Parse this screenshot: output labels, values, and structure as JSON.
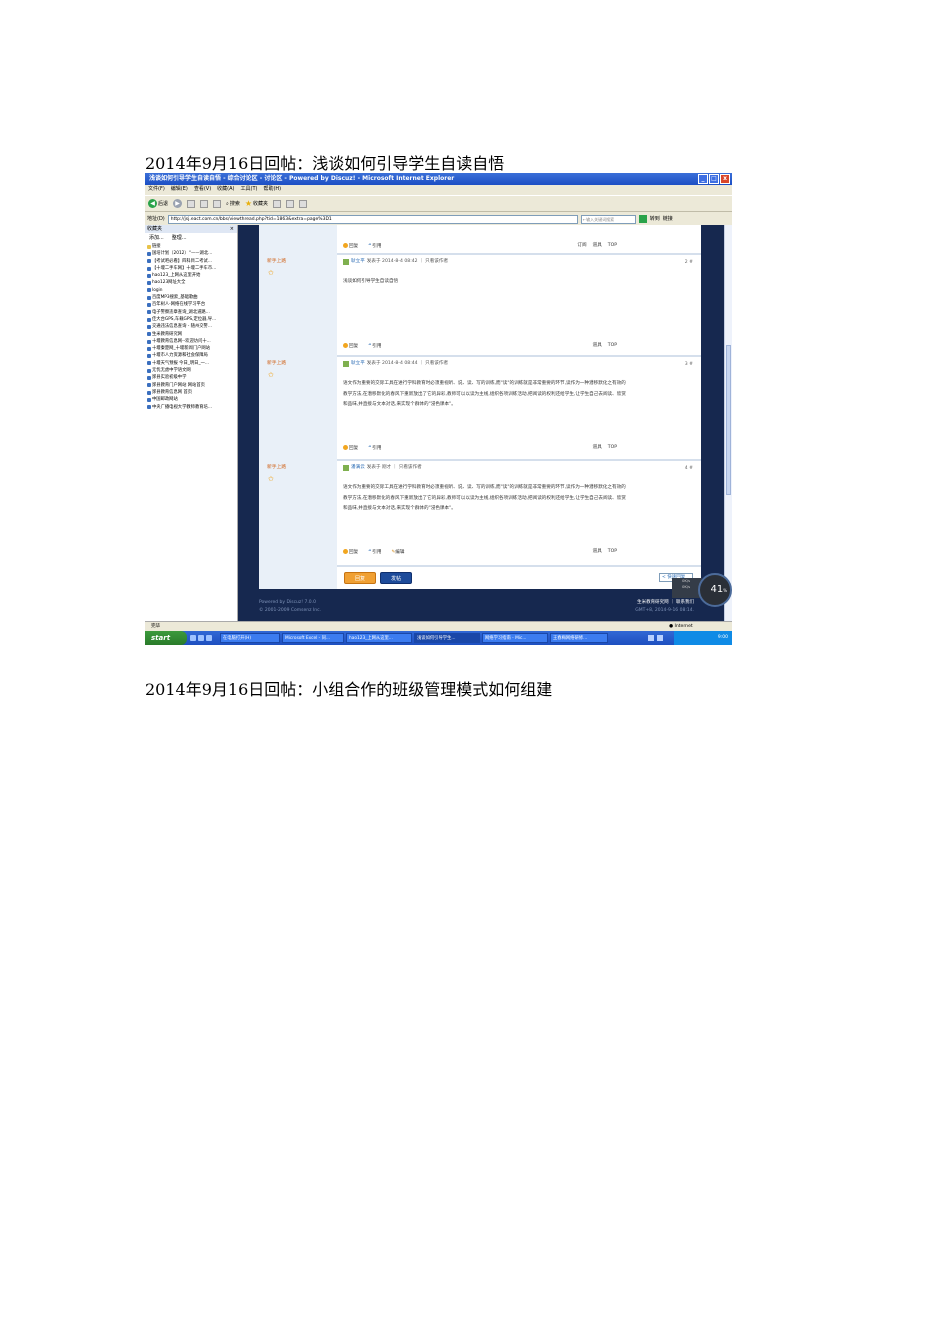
{
  "captions": {
    "first": "2014年9月16日回帖：浅谈如何引导学生自读自悟",
    "second": "2014年9月16日回帖：小组合作的班级管理模式如何组建"
  },
  "window": {
    "title": "浅谈如何引导学生自读自悟 - 综合讨论区 - 讨论区 - Powered by Discuz! - Microsoft Internet Explorer",
    "min": "_",
    "max": "□",
    "close": "x"
  },
  "menu": [
    "文件(F)",
    "编辑(E)",
    "查看(V)",
    "收藏(A)",
    "工具(T)",
    "帮助(H)"
  ],
  "toolbar": {
    "back": "后退",
    "search": "搜索",
    "favorites": "收藏夹"
  },
  "address": {
    "label": "地址(D)",
    "url": "http://jsj.eact.com.cn/bbs/viewthread.php?tid=1863&extra=page%3D1",
    "search_placeholder": "←输入关键词搜索",
    "go": "转到",
    "links": "链接"
  },
  "favorites": {
    "title": "收藏夹",
    "close": "×",
    "add": "添加...",
    "organize": "整理...",
    "items": [
      {
        "label": "链接",
        "folder": true
      },
      {
        "label": "国培计划（2012）“——湖北...",
        "folder": false
      },
      {
        "label": "【考试吧必看】四科目二考试...",
        "folder": false
      },
      {
        "label": "【十堰二手车网】十堰二手车市...",
        "folder": false
      },
      {
        "label": "hao123_上网从这里开始",
        "folder": false
      },
      {
        "label": "hao123网址大全",
        "folder": false
      },
      {
        "label": "login",
        "folder": false
      },
      {
        "label": "百度MP3搜索_基础歌曲",
        "folder": false
      },
      {
        "label": "百年树人-网络在线学习平台",
        "folder": false
      },
      {
        "label": "电子警察违章查询_湖北道路...",
        "folder": false
      },
      {
        "label": "佳大台GPS,车载GPS,定位器,导...",
        "folder": false
      },
      {
        "label": "交通违法信息查询 - 随州交警...",
        "folder": false
      },
      {
        "label": "生米教育研究网",
        "folder": false
      },
      {
        "label": "十堰教育信息网--欢迎访问十...",
        "folder": false
      },
      {
        "label": "十堰秦楚网_十堰新闻门户网站",
        "folder": false
      },
      {
        "label": "十堰市人力资源和社会保障局",
        "folder": false
      },
      {
        "label": "十堰天气预报 今日_明日_一...",
        "folder": false
      },
      {
        "label": "无忧无虑中学语文网",
        "folder": false
      },
      {
        "label": "郧县实验初级中学",
        "folder": false
      },
      {
        "label": "郧县教育门户网站 网站首页",
        "folder": false
      },
      {
        "label": "郧县教育信息网 首页",
        "folder": false
      },
      {
        "label": "中国邮政网站",
        "folder": false
      },
      {
        "label": "中央广播电视大学教师教育培...",
        "folder": false
      }
    ]
  },
  "forum": {
    "actions": {
      "reply": "回复",
      "quote": "引用",
      "edit": "编辑",
      "subscribe": "订阅",
      "tools": "道具",
      "top": "TOP"
    },
    "posts": [
      {
        "author": "新手上路",
        "name": "耿立平",
        "meta": "发表于 2014-8-4 08:42 ｜ 只看该作者",
        "floor": "2 #",
        "body": "浅谈如何引导学生自读自悟"
      },
      {
        "author": "新手上路",
        "name": "耿立平",
        "meta": "发表于 2014-8-4 08:44 ｜ 只看该作者",
        "floor": "3 #",
        "body": "语文作为重要的交际工具在进行学科教育时必须重视听、说、读、写的训练,而\"读\"的训练就是非常重要的环节,读作为一种潜移默化之有效的教学方法,在潜移默化的春风下重新放出了它的异彩,教师可以以读为主线,组织各项训练活动,把阅读的权利还给学生,让学生自己去阅读、欣赏和品味,并直接与文本对话,来实现个群体的\"浸色课本\"。"
      },
      {
        "author": "新手上路",
        "name": "潘满云",
        "meta": "发表于 刚才 ｜ 只看该作者",
        "floor": "4 #",
        "body": "语文作为重要的交际工具在进行学科教育时必须重视听、说、读、写的训练,而\"读\"的训练就是非常重要的环节,读作为一种潜移默化之有效的教学方法,在潜移默化的春风下重新放出了它的异彩,教师可以以读为主线,组织各项训练活动,把阅读的权利还给学生,让学生自己去阅读、欣赏和品味,并直接与文本对话,来实现个群体的\"浸色课本\"。"
      }
    ],
    "buttons": {
      "reply": "回复",
      "post": "发帖"
    },
    "quick": "< 快速回复",
    "footer_left": [
      "Powered by Discuz! 7.0.0",
      "© 2001-2009 Comsenz Inc."
    ],
    "footer_right": [
      "生米教育研究网 ｜ 联系我们",
      "GMT+8, 2014-9-16 08:14."
    ]
  },
  "gauge": {
    "value": "41",
    "unit": "%",
    "up": "0K/s",
    "down": "0K/s"
  },
  "status": {
    "left": "完毕",
    "zone": "Internet"
  },
  "taskbar": {
    "start": "start",
    "tasks": [
      "在电脑打开(H)",
      "Microsoft Excel - 同...",
      "hao123_上网从这里...",
      "浅谈如何引导学生...",
      "网络学习指南 - Mic...",
      "王春梅网络研修..."
    ],
    "clock": "9:00"
  }
}
